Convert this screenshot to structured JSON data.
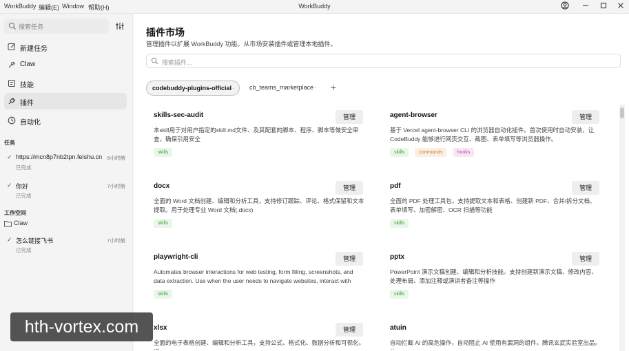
{
  "titlebar": {
    "app_name": "WorkBuddy",
    "menus": [
      "编辑(E)",
      "Window",
      "帮助(H)"
    ],
    "window_title": "WorkBuddy"
  },
  "sidebar": {
    "search_placeholder": "搜索任务",
    "nav": [
      {
        "label": "新建任务",
        "icon": "edit-icon"
      },
      {
        "label": "Claw",
        "icon": "claw-icon"
      },
      {
        "label": "技能",
        "icon": "skill-icon"
      },
      {
        "label": "插件",
        "icon": "plugin-icon",
        "active": true
      },
      {
        "label": "自动化",
        "icon": "clock-icon"
      }
    ],
    "tasks_title": "任务",
    "tasks": [
      {
        "name": "https://mcn8p7nb2tpn.feishu.cn",
        "time": "6小时前",
        "status": "已完成"
      },
      {
        "name": "你好",
        "time": "7小时前",
        "status": "已完成"
      }
    ],
    "workspace_title": "工作空间",
    "workspace": {
      "label": "Claw"
    },
    "workspace_tasks": [
      {
        "name": "怎么链接飞书",
        "time": "7小时前",
        "status": "已完成"
      }
    ]
  },
  "main": {
    "title": "插件市场",
    "subtitle": "管理插件以扩展 WorkBuddy 功能。从市场安装插件或管理本地插件。",
    "search_placeholder": "搜索插件...",
    "tabs": [
      {
        "label": "codebuddy-plugins-official",
        "active": true
      },
      {
        "label": "cb_teams_marketplace",
        "active": false
      }
    ],
    "tab_more": "···",
    "add_tab": "+",
    "manage_label": "管理",
    "plugins": [
      {
        "name": "skills-sec-audit",
        "desc": "本skill用于对用户指定的skill.md文件、及其配套的脚本、程序、脚本等做安全审查，确保引用安全",
        "tags": [
          "skills"
        ]
      },
      {
        "name": "agent-browser",
        "desc": "基于 Vercel agent-browser CLI 的浏览器自动化插件。首次使用时自动安装，让 CodeBuddy 能够进行网页交互、截图、表单填写等浏览器操作。",
        "tags": [
          "skills",
          "commands",
          "hooks"
        ]
      },
      {
        "name": "docx",
        "desc": "全面的 Word 文档创建、编辑和分析工具，支持修订跟踪、评论、格式保留和文本提取。用于处理专业 Word 文档(.docx)",
        "tags": [
          "skills"
        ]
      },
      {
        "name": "pdf",
        "desc": "全面的 PDF 处理工具包，支持提取文本和表格、创建新 PDF、合并/拆分文档、表单填写、加密解密、OCR 扫描等功能",
        "tags": [
          "skills"
        ]
      },
      {
        "name": "playwright-cli",
        "desc": "Automates browser interactions for web testing, form filling, screenshots, and data extraction. Use when the user needs to navigate websites, interact with we...",
        "tags": [
          "skills"
        ]
      },
      {
        "name": "pptx",
        "desc": "PowerPoint 演示文稿创建、编辑和分析技能。支持创建新演示文稿、修改内容、处理布局、添加注释或演讲者备注等操作",
        "tags": [
          "skills"
        ]
      },
      {
        "name": "xlsx",
        "desc": "全面的电子表格创建、编辑和分析工具，支持公式、格式化、数据分析和可视化。适",
        "tags": []
      },
      {
        "name": "atuin",
        "desc": "自动拦截 AI 的高危操作，自动阻止 AI 使用有漏洞的组件。腾讯玄武实验室出品。让",
        "tags": []
      }
    ]
  },
  "watermark": "hth-vortex.com"
}
